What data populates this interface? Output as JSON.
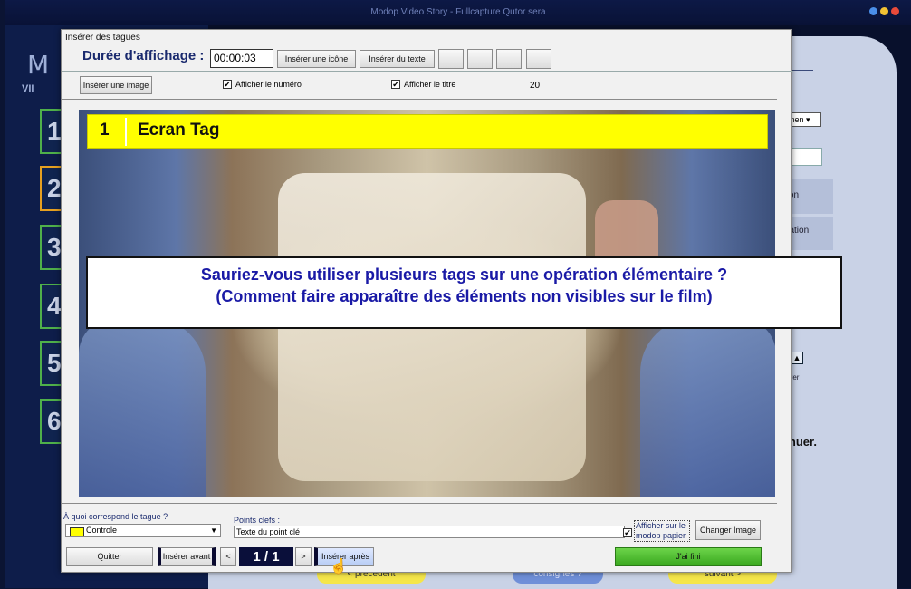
{
  "background_app": {
    "window_title": "Modop Video Story - Fullcapture Qutor sera",
    "logo_letter": "M",
    "logo_sub": "VII",
    "step_numbers": [
      "1",
      "2",
      "3",
      "4",
      "5",
      "6"
    ],
    "dropdown_value": "élémen",
    "row1_text": "ration",
    "row2_text": "pération",
    "accelerate_label": "célérer",
    "continue_text": "ntinuer.",
    "prev_button": "< précédent",
    "consignes_button": "consignes ?",
    "next_button": "suivant >"
  },
  "dialog": {
    "title": "Insérer des tagues",
    "duree_label": "Durée d'affichage :",
    "duree_value": "00:00:03",
    "insert_icon_button": "Insérer une icône",
    "insert_text_button": "Insérer du texte",
    "insert_image_button": "Insérer une image",
    "show_number_label": "Afficher le numéro",
    "show_number_checked": "✔",
    "show_title_label": "Afficher le titre",
    "show_title_checked": "✔",
    "count_value": "20",
    "tag_number": "1",
    "tag_title": "Ecran Tag",
    "question_line1": "Sauriez-vous utiliser plusieurs tags sur une opération élémentaire ?",
    "question_line2": "(Comment faire apparaître des éléments non visibles sur le film)",
    "tag_correspond_label": "À quoi correspond le tague ?",
    "tag_correspond_value": "Controle",
    "points_label": "Points clefs :",
    "points_value": "Texte du point clé",
    "show_paper_label": "Afficher sur le modop papier",
    "show_paper_checked": "✔",
    "change_image_button": "Changer Image",
    "quit_button": "Quitter",
    "insert_before_button": "Insérer avant",
    "prev_arrow": "<",
    "page_indicator": "1 / 1",
    "next_arrow": ">",
    "insert_after_button": "Insérer après",
    "done_button": "J'ai fini"
  },
  "colors": {
    "tag_yellow": "#ffff00",
    "question_blue": "#1a1aa6",
    "done_green": "#4cbf2c"
  }
}
